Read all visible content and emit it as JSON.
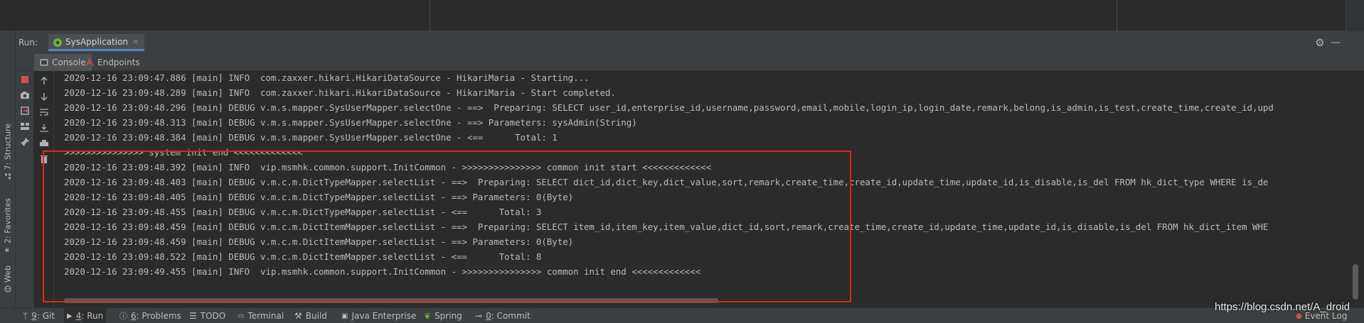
{
  "run": {
    "label": "Run:",
    "tab_title": "SysApplication",
    "tab_close": "×"
  },
  "subtabs": [
    {
      "label": "Console",
      "icon": "console-icon"
    },
    {
      "label": "Endpoints",
      "icon": "endpoints-icon"
    }
  ],
  "left_strip": {
    "structure": "7: Structure",
    "favorites": "2: Favorites",
    "web": "Web"
  },
  "console": {
    "lines": [
      "2020-12-16 23:09:47.886 [main] INFO  com.zaxxer.hikari.HikariDataSource - HikariMaria - Starting...",
      "2020-12-16 23:09:48.289 [main] INFO  com.zaxxer.hikari.HikariDataSource - HikariMaria - Start completed.",
      "2020-12-16 23:09:48.296 [main] DEBUG v.m.s.mapper.SysUserMapper.selectOne - ==>  Preparing: SELECT user_id,enterprise_id,username,password,email,mobile,login_ip,login_date,remark,belong,is_admin,is_test,create_time,create_id,upd",
      "2020-12-16 23:09:48.313 [main] DEBUG v.m.s.mapper.SysUserMapper.selectOne - ==> Parameters: sysAdmin(String)",
      "2020-12-16 23:09:48.384 [main] DEBUG v.m.s.mapper.SysUserMapper.selectOne - <==      Total: 1",
      ">>>>>>>>>>>>>>> system init end <<<<<<<<<<<<<",
      "2020-12-16 23:09:48.392 [main] INFO  vip.msmhk.common.support.InitCommon - >>>>>>>>>>>>>>> common init start <<<<<<<<<<<<<",
      "2020-12-16 23:09:48.403 [main] DEBUG v.m.c.m.DictTypeMapper.selectList - ==>  Preparing: SELECT dict_id,dict_key,dict_value,sort,remark,create_time,create_id,update_time,update_id,is_disable,is_del FROM hk_dict_type WHERE is_de",
      "2020-12-16 23:09:48.405 [main] DEBUG v.m.c.m.DictTypeMapper.selectList - ==> Parameters: 0(Byte)",
      "2020-12-16 23:09:48.455 [main] DEBUG v.m.c.m.DictTypeMapper.selectList - <==      Total: 3",
      "2020-12-16 23:09:48.459 [main] DEBUG v.m.c.m.DictItemMapper.selectList - ==>  Preparing: SELECT item_id,item_key,item_value,dict_id,sort,remark,create_time,create_id,update_time,update_id,is_disable,is_del FROM hk_dict_item WHE",
      "2020-12-16 23:09:48.459 [main] DEBUG v.m.c.m.DictItemMapper.selectList - ==> Parameters: 0(Byte)",
      "2020-12-16 23:09:48.522 [main] DEBUG v.m.c.m.DictItemMapper.selectList - <==      Total: 8",
      "2020-12-16 23:09:49.455 [main] INFO  vip.msmhk.common.support.InitCommon - >>>>>>>>>>>>>>> common init end <<<<<<<<<<<<<"
    ]
  },
  "bottom_tabs": [
    {
      "prefix": "9",
      "label": ": Git",
      "icon": "git-branch-icon"
    },
    {
      "prefix": "4",
      "label": ": Run",
      "icon": "run-icon",
      "active": true
    },
    {
      "prefix": "6",
      "label": ": Problems",
      "icon": "problems-icon"
    },
    {
      "prefix": "",
      "label": "TODO",
      "icon": "todo-icon"
    },
    {
      "prefix": "",
      "label": "Terminal",
      "icon": "terminal-icon"
    },
    {
      "prefix": "",
      "label": "Build",
      "icon": "build-icon"
    },
    {
      "prefix": "",
      "label": "Java Enterprise",
      "icon": "java-enterprise-icon"
    },
    {
      "prefix": "",
      "label": "Spring",
      "icon": "spring-icon"
    },
    {
      "prefix": "0",
      "label": ": Commit",
      "icon": "commit-icon"
    }
  ],
  "event_log": "Event Log",
  "watermark": "https://blog.csdn.net/A_droid",
  "colors": {
    "highlight": "#e2241d",
    "background": "#2b2b2b",
    "panel": "#3c3f41",
    "text": "#bbbbbb"
  }
}
